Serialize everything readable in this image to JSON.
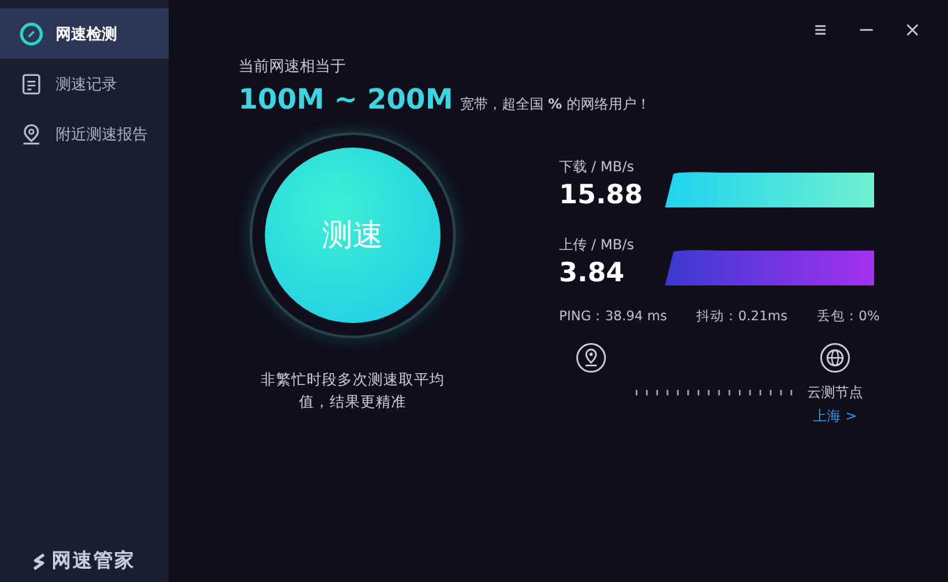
{
  "sidebar": {
    "items": [
      {
        "label": "网速检测",
        "selected": true
      },
      {
        "label": "测速记录",
        "selected": false
      },
      {
        "label": "附近测速报告",
        "selected": false
      }
    ],
    "logo": "网速管家"
  },
  "header": {
    "subtitle": "当前网速相当于",
    "bandwidth": "100M ~ 200M",
    "summary": "宽带，超全国 **%** 的网络用户！"
  },
  "test_button": "测速",
  "hint": "非繁忙时段多次测速取平均值，结果更精准",
  "download": {
    "label": "下载 / MB/s",
    "value": "15.88"
  },
  "upload": {
    "label": "上传 / MB/s",
    "value": "3.84"
  },
  "stats": [
    "PING：38.94 ms",
    "抖动：0.21ms",
    "丢包：0%"
  ],
  "node": {
    "label": "云测节点",
    "location": "上海 >"
  }
}
